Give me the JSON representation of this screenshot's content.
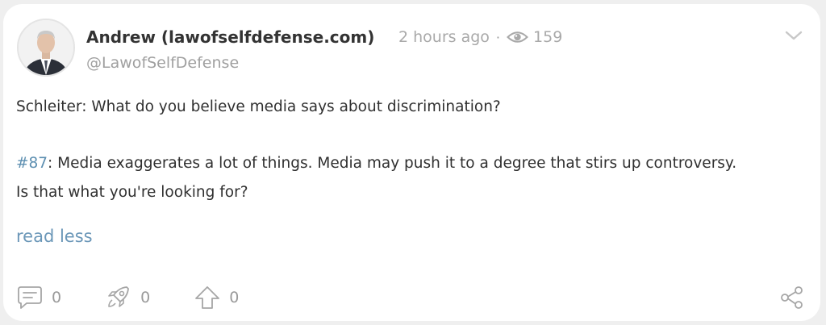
{
  "post": {
    "author_name": "Andrew (lawofselfdefense.com)",
    "handle": "@LawofSelfDefense",
    "time_ago": "2 hours ago",
    "separator": "·",
    "view_count": "159",
    "paragraph1": "Schleiter: What do you believe media says about discrimination?",
    "hashtag": "#87",
    "paragraph2_rest": ": Media exaggerates a lot of things. Media may push it to a degree that stirs up controversy. Is that what you're looking for?",
    "read_less_label": "read less"
  },
  "actions": {
    "comment_count": "0",
    "repost_count": "0",
    "upvote_count": "0"
  },
  "icons": {
    "avatar": "avatar-photo",
    "views": "eye-icon",
    "collapse": "chevron-down-icon",
    "comment": "comment-icon",
    "repost": "rocket-icon",
    "upvote": "upvote-arrow-icon",
    "share": "share-icon"
  },
  "colors": {
    "link": "#6b97b8",
    "hashtag": "#5d8fb1",
    "muted": "#a9a9a9",
    "text": "#303030",
    "card": "#ffffff",
    "background": "#efefef"
  }
}
